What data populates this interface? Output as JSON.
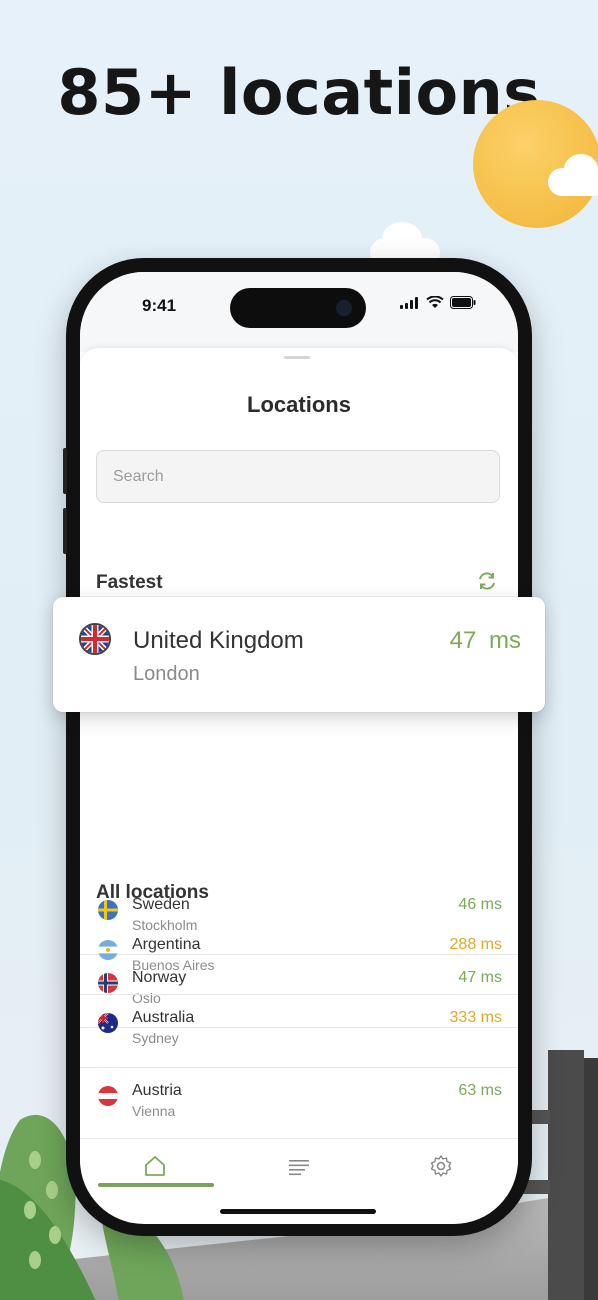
{
  "headline": "85+ locations",
  "status_bar": {
    "time": "9:41"
  },
  "screen": {
    "title": "Locations",
    "search": {
      "placeholder": "Search"
    }
  },
  "fastest": {
    "title": "Fastest",
    "highlighted": {
      "country": "United Kingdom",
      "city": "London",
      "ping": "47  ms"
    },
    "items": [
      {
        "country": "Sweden",
        "city": "Stockholm",
        "ping": "46 ms"
      },
      {
        "country": "Norway",
        "city": "Oslo",
        "ping": "47 ms"
      }
    ]
  },
  "all_locations": {
    "title": "All locations",
    "items": [
      {
        "country": "Argentina",
        "city": "Buenos Aires",
        "ping": "288 ms",
        "ping_color": "#e2a92a"
      },
      {
        "country": "Australia",
        "city": "Sydney",
        "ping": "333 ms",
        "ping_color": "#e2a92a"
      },
      {
        "country": "Austria",
        "city": "Vienna",
        "ping": "63 ms",
        "ping_color": "#7caa57"
      }
    ]
  },
  "tabs": [
    {
      "icon": "home-icon",
      "active": true
    },
    {
      "icon": "list-icon",
      "active": false
    },
    {
      "icon": "gear-icon",
      "active": false
    }
  ],
  "colors": {
    "accent_green": "#7caa57",
    "ping_warn": "#e2a92a",
    "sun": "#f6c04a"
  }
}
